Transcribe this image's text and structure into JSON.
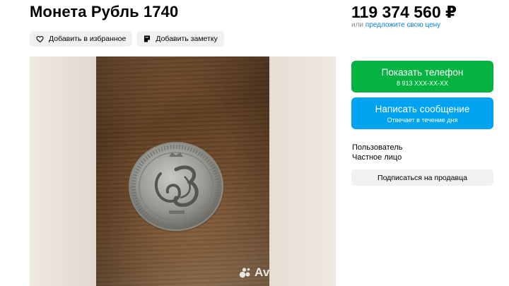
{
  "listing": {
    "title": "Монета Рубль 1740"
  },
  "actions": {
    "favorite_label": "Добавить в избранное",
    "note_label": "Добавить заметку"
  },
  "gallery": {
    "watermark": "Avito"
  },
  "pricing": {
    "price": "119 374 560 ₽",
    "or_text": "или",
    "offer_link": "предложите свою цену"
  },
  "contact": {
    "phone_label": "Показать телефон",
    "phone_masked": "8 913 XXX-XX-XX",
    "message_label": "Написать сообщение",
    "message_sub": "Отвечает в течение дня"
  },
  "seller": {
    "role": "Пользователь",
    "type": "Частное лицо",
    "subscribe_label": "Подписаться на продавца"
  },
  "colors": {
    "phone_button": "#04b340",
    "message_button": "#00a3f0",
    "link": "#0a84d8",
    "chip_bg": "#f2f1f0"
  },
  "icons": {
    "favorite": "heart-icon",
    "note": "note-icon",
    "watermark": "avito-logo-icon"
  }
}
